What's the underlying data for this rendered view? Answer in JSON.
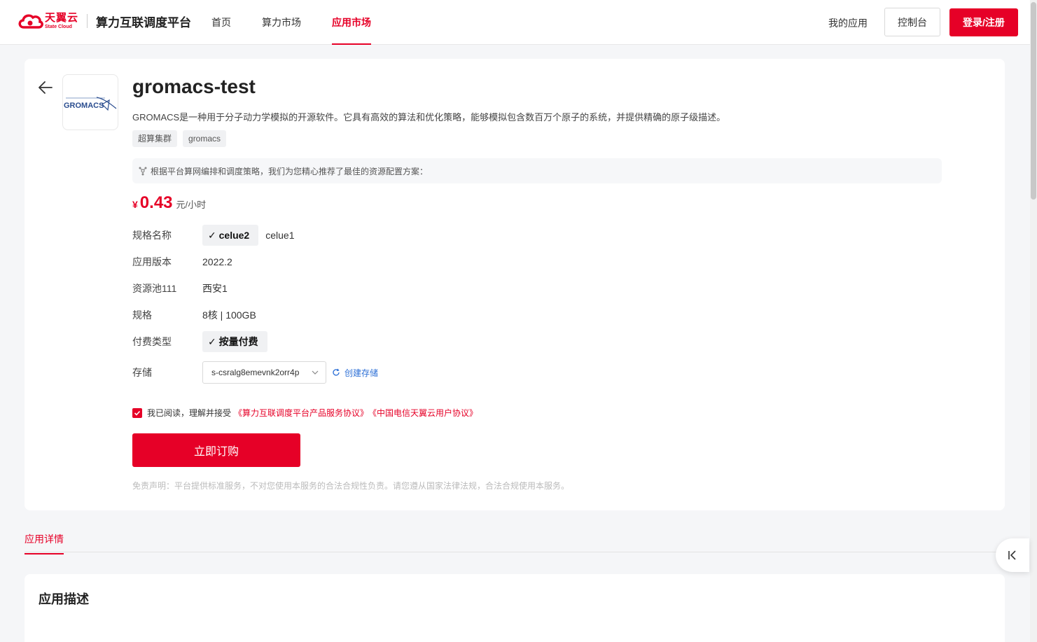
{
  "header": {
    "logo_cn": "天翼云",
    "logo_en": "State Cloud",
    "platform": "算力互联调度平台",
    "nav": [
      "首页",
      "算力市场",
      "应用市场"
    ],
    "active_nav": "应用市场",
    "my_apps": "我的应用",
    "console": "控制台",
    "login": "登录/注册"
  },
  "app": {
    "logo_text": "GROMACS",
    "title": "gromacs-test",
    "description": "GROMACS是一种用于分子动力学模拟的开源软件。它具有高效的算法和优化策略，能够模拟包含数百万个原子的系统，并提供精确的原子级描述。",
    "tags": [
      "超算集群",
      "gromacs"
    ],
    "tip": "根据平台算网编排和调度策略，我们为您精心推荐了最佳的资源配置方案："
  },
  "price": {
    "symbol": "¥",
    "value": "0.43",
    "unit": "元/小时"
  },
  "spec": {
    "name_label": "规格名称",
    "options": [
      "celue2",
      "celue1"
    ],
    "selected": "celue2",
    "version_label": "应用版本",
    "version": "2022.2",
    "pool_label": "资源池111",
    "pool": "西安1",
    "size_label": "规格",
    "size": "8核 | 100GB",
    "pay_label": "付费类型",
    "pay": "按量付费",
    "storage_label": "存储",
    "storage_value": "s-csralg8emevnk2orr4p",
    "create_storage": "创建存储"
  },
  "agreement": {
    "text": "我已阅读，理解并接受",
    "link1": "《算力互联调度平台产品服务协议》",
    "link2": "《中国电信天翼云用户协议》",
    "checked": true
  },
  "order_button": "立即订购",
  "disclaimer": "免责声明：平台提供标准服务，不对您使用本服务的合法合规性负责。请您遵从国家法律法规，合法合规使用本服务。",
  "tabs": {
    "detail": "应用详情"
  },
  "section": {
    "title": "应用描述"
  },
  "colors": {
    "brand": "#e60027",
    "link": "#2c6fd6"
  }
}
